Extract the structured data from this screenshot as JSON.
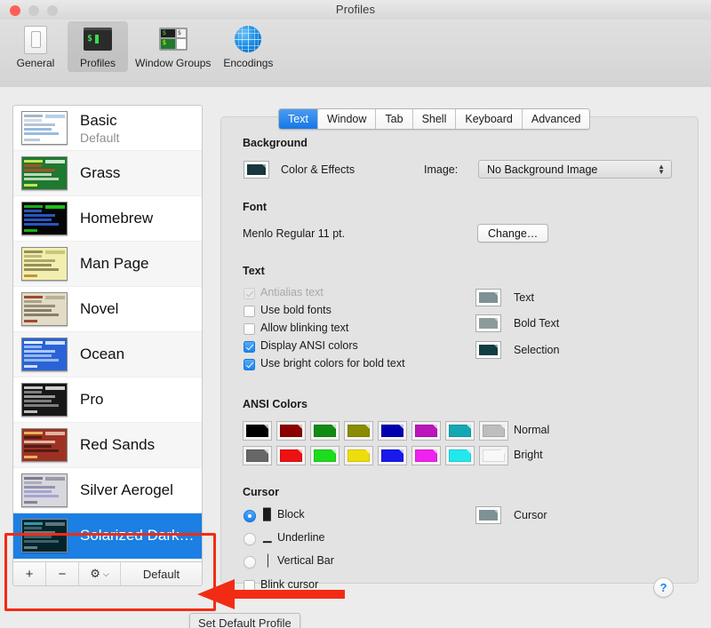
{
  "window": {
    "title": "Profiles",
    "traffic_lights": [
      "close",
      "minimize",
      "zoom"
    ]
  },
  "toolbar": {
    "items": [
      {
        "label": "General",
        "icon": "device-icon",
        "selected": false
      },
      {
        "label": "Profiles",
        "icon": "terminal-icon",
        "selected": true
      },
      {
        "label": "Window Groups",
        "icon": "window-groups-icon",
        "selected": false
      },
      {
        "label": "Encodings",
        "icon": "globe-icon",
        "selected": false
      }
    ]
  },
  "profiles": {
    "items": [
      {
        "name": "Basic",
        "subtitle": "Default",
        "selected": false
      },
      {
        "name": "Grass",
        "subtitle": "",
        "selected": false
      },
      {
        "name": "Homebrew",
        "subtitle": "",
        "selected": false
      },
      {
        "name": "Man Page",
        "subtitle": "",
        "selected": false
      },
      {
        "name": "Novel",
        "subtitle": "",
        "selected": false
      },
      {
        "name": "Ocean",
        "subtitle": "",
        "selected": false
      },
      {
        "name": "Pro",
        "subtitle": "",
        "selected": false
      },
      {
        "name": "Red Sands",
        "subtitle": "",
        "selected": false
      },
      {
        "name": "Silver Aerogel",
        "subtitle": "",
        "selected": false
      },
      {
        "name": "Solarized Dark…",
        "subtitle": "",
        "selected": true
      }
    ],
    "actions": {
      "add_label": "+",
      "remove_label": "−",
      "gear_label": "⚙",
      "gear_chevron": "⌵",
      "default_label": "Default"
    },
    "selection_color": "#1b7fe3"
  },
  "tabs": [
    {
      "label": "Text",
      "active": true
    },
    {
      "label": "Window",
      "active": false
    },
    {
      "label": "Tab",
      "active": false
    },
    {
      "label": "Shell",
      "active": false
    },
    {
      "label": "Keyboard",
      "active": false
    },
    {
      "label": "Advanced",
      "active": false
    }
  ],
  "text_tab": {
    "background": {
      "section_title": "Background",
      "color_effects_label": "Color & Effects",
      "color_effects_swatch": "#17383d",
      "image_label": "Image:",
      "image_value": "No Background Image"
    },
    "font": {
      "section_title": "Font",
      "value": "Menlo Regular 11 pt.",
      "change_label": "Change…"
    },
    "text": {
      "section_title": "Text",
      "checkboxes": [
        {
          "label": "Antialias text",
          "checked": true,
          "disabled": true
        },
        {
          "label": "Use bold fonts",
          "checked": false,
          "disabled": false
        },
        {
          "label": "Allow blinking text",
          "checked": false,
          "disabled": false
        },
        {
          "label": "Display ANSI colors",
          "checked": true,
          "disabled": false
        },
        {
          "label": "Use bright colors for bold text",
          "checked": true,
          "disabled": false
        }
      ],
      "color_wells": [
        {
          "label": "Text",
          "color": "#7d9295"
        },
        {
          "label": "Bold Text",
          "color": "#8b9c9b"
        },
        {
          "label": "Selection",
          "color": "#123c43"
        }
      ]
    },
    "ansi_colors": {
      "section_title": "ANSI Colors",
      "normal_label": "Normal",
      "bright_label": "Bright",
      "normal": [
        "#000000",
        "#8b0000",
        "#128b12",
        "#8b8b00",
        "#0000b0",
        "#bb15bb",
        "#13a8b4",
        "#bebebe"
      ],
      "bright": [
        "#676767",
        "#ee1111",
        "#1ddc1d",
        "#efdd0b",
        "#1919ee",
        "#ef22ef",
        "#22e8ee",
        "#f8f8f8"
      ]
    },
    "cursor": {
      "section_title": "Cursor",
      "options": [
        {
          "label": "Block",
          "glyph": "█",
          "selected": true
        },
        {
          "label": "Underline",
          "glyph": "▁",
          "selected": false
        },
        {
          "label": "Vertical Bar",
          "glyph": "│",
          "selected": false
        }
      ],
      "blink_label": "Blink cursor",
      "blink_checked": false,
      "well_label": "Cursor",
      "well_color": "#7d9295"
    }
  },
  "help": {
    "label": "?"
  },
  "tooltip": {
    "text": "Set Default Profile"
  },
  "annotations": {
    "highlight_color": "#f22c14"
  }
}
